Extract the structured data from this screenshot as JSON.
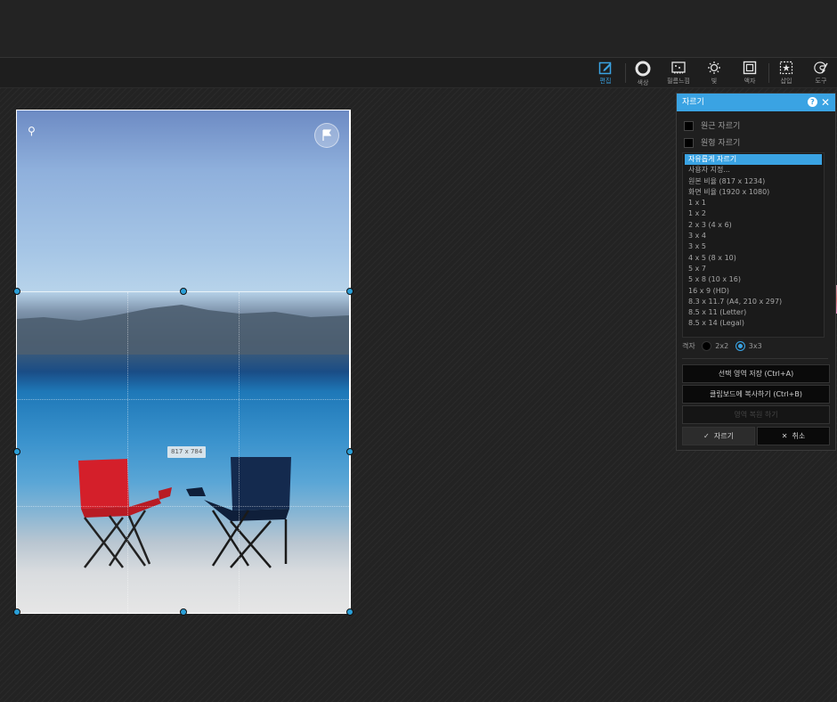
{
  "toolbar": {
    "tools": [
      {
        "label": "편집",
        "icon": "edit-icon",
        "active": true
      },
      {
        "label": "색상",
        "icon": "color-icon"
      },
      {
        "label": "필름느낌",
        "icon": "film-icon"
      },
      {
        "label": "빛",
        "icon": "light-icon"
      },
      {
        "label": "액자",
        "icon": "frame-icon"
      },
      {
        "label": "삽입",
        "icon": "insert-icon"
      },
      {
        "label": "도구",
        "icon": "tools-icon"
      }
    ]
  },
  "canvas": {
    "selection_size": "817 x 784"
  },
  "crop_panel": {
    "title": "자르기",
    "round_crop_label": "원근 자르기",
    "circle_crop_label": "원형 자르기",
    "ratios": [
      "자유롭게 자르기",
      "사용자 지정...",
      "원본 비율 (817 x 1234)",
      "화면 비율 (1920 x 1080)",
      "1 x 1",
      "1 x 2",
      "2 x 3 (4 x 6)",
      "3 x 4",
      "3 x 5",
      "4 x 5 (8 x 10)",
      "5 x 7",
      "5 x 8 (10 x 16)",
      "16 x 9 (HD)",
      "8.3 x 11.7 (A4, 210 x 297)",
      "8.5 x 11 (Letter)",
      "8.5 x 14 (Legal)"
    ],
    "selected_ratio": "자유롭게 자르기",
    "grid_label": "격자",
    "grid_option_1": "2x2",
    "grid_option_2": "3x3",
    "grid_selected": "3x3",
    "save_selection_label": "선택 영역 저장 (Ctrl+A)",
    "copy_clipboard_label": "클립보드에 복사하기 (Ctrl+B)",
    "disabled_label": "영역 복원 하기",
    "crop_label": "자르기",
    "cancel_label": "취소",
    "accent_color": "#3aa3e3"
  }
}
